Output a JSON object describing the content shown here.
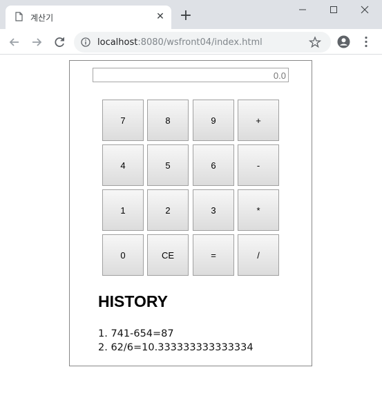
{
  "browser": {
    "tab_title": "계산기",
    "url_host": "localhost",
    "url_rest": ":8080/wsfront04/index.html"
  },
  "calculator": {
    "display_value": "0.0",
    "keys": [
      [
        "7",
        "8",
        "9",
        "+"
      ],
      [
        "4",
        "5",
        "6",
        "-"
      ],
      [
        "1",
        "2",
        "3",
        "*"
      ],
      [
        "0",
        "CE",
        "=",
        "/"
      ]
    ]
  },
  "history": {
    "title": "HISTORY",
    "entries": [
      "1. 741-654=87",
      "2. 62/6=10.333333333333334"
    ]
  }
}
